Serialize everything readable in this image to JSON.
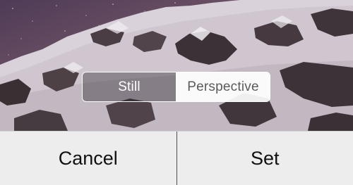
{
  "wallpaper": {
    "description_icon": "mountain-wallpaper"
  },
  "mode_toggle": {
    "options": [
      "Still",
      "Perspective"
    ],
    "selected": "Still"
  },
  "actions": {
    "cancel_label": "Cancel",
    "set_label": "Set"
  },
  "colors": {
    "sky": "#5a4660",
    "snow": "#e9e4ea",
    "rock": "#3a3034",
    "bar_background": "#ededed",
    "divider": "#4a4f4a"
  }
}
